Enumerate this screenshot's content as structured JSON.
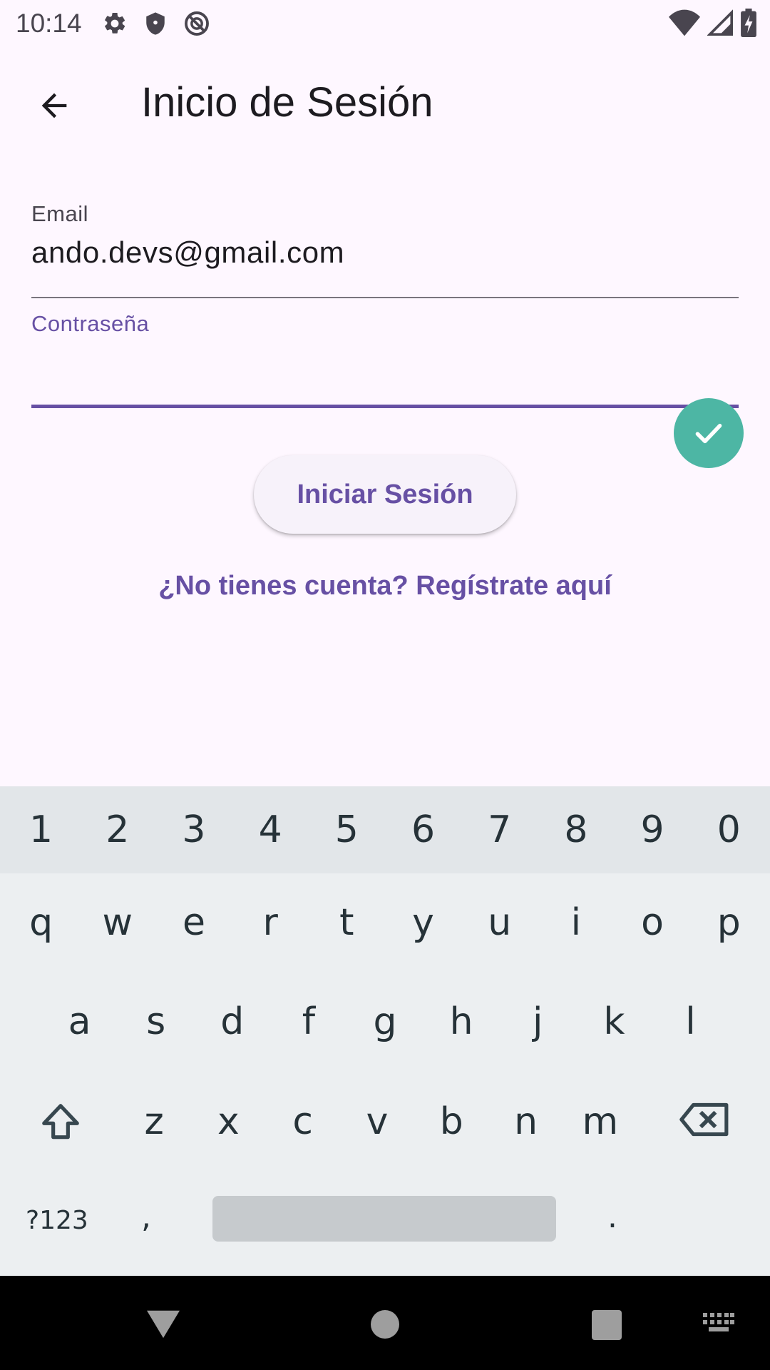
{
  "status_bar": {
    "time": "10:14",
    "icons_left": [
      "settings-icon",
      "shield-icon",
      "do-not-disturb-icon"
    ],
    "icons_right": [
      "wifi-icon",
      "signal-icon",
      "battery-charging-icon"
    ]
  },
  "app_bar": {
    "title": "Inicio de Sesión",
    "back_icon": "arrow-back-icon"
  },
  "form": {
    "email_label": "Email",
    "email_value": "ando.devs@gmail.com",
    "password_label": "Contraseña",
    "password_value": "",
    "login_button": "Iniciar Sesión",
    "register_link": "¿No tienes cuenta? Regístrate aquí"
  },
  "keyboard": {
    "number_row": [
      "1",
      "2",
      "3",
      "4",
      "5",
      "6",
      "7",
      "8",
      "9",
      "0"
    ],
    "row1": [
      "q",
      "w",
      "e",
      "r",
      "t",
      "y",
      "u",
      "i",
      "o",
      "p"
    ],
    "row2": [
      "a",
      "s",
      "d",
      "f",
      "g",
      "h",
      "j",
      "k",
      "l"
    ],
    "row3": [
      "z",
      "x",
      "c",
      "v",
      "b",
      "n",
      "m"
    ],
    "symbols_key": "?123",
    "comma_key": ",",
    "period_key": ".",
    "enter_icon": "check-icon"
  },
  "colors": {
    "primary": "#6750A4",
    "background": "#FEF7FF",
    "keyboard_bg": "#ECEFF1",
    "enter_key": "#4DB6A4"
  }
}
